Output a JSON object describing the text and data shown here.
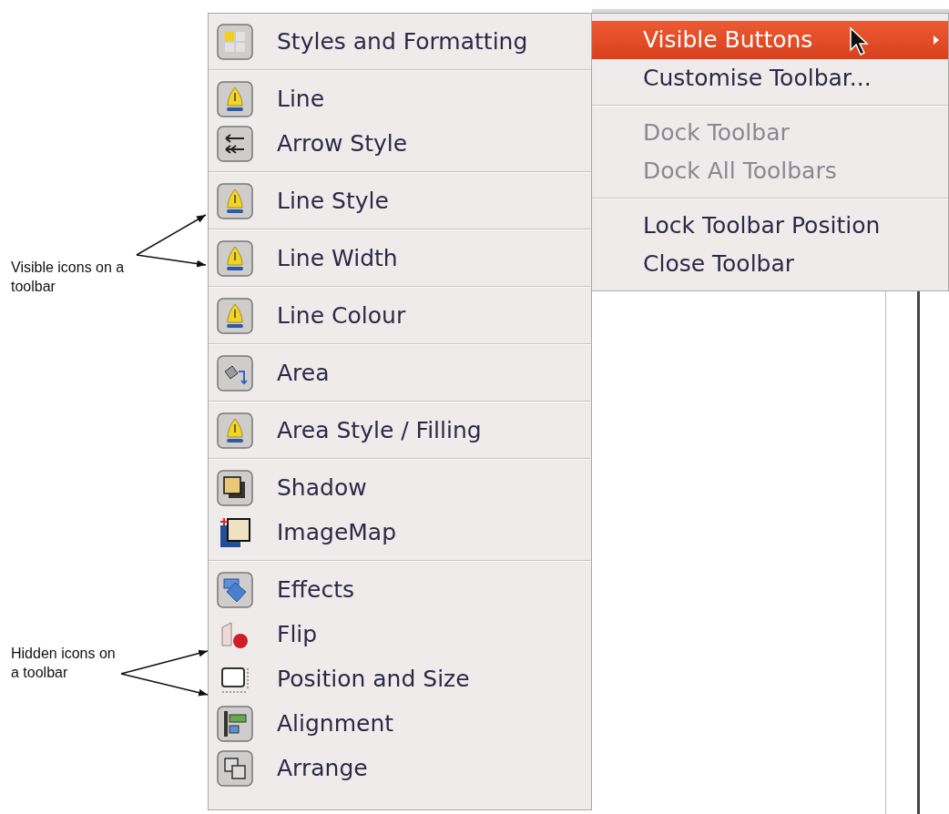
{
  "annotations": [
    {
      "text": "Visible icons on a toolbar"
    },
    {
      "text": "Hidden icons on a toolbar"
    }
  ],
  "menu": {
    "groups": [
      {
        "items": [
          {
            "label": "Styles and Formatting",
            "kind": "styles",
            "visible": true
          }
        ]
      },
      {
        "items": [
          {
            "label": "Line",
            "kind": "pen",
            "visible": true
          },
          {
            "label": "Arrow Style",
            "kind": "arrows",
            "visible": true
          }
        ]
      },
      {
        "items": [
          {
            "label": "Line Style",
            "kind": "pen",
            "visible": true
          }
        ]
      },
      {
        "items": [
          {
            "label": "Line Width",
            "kind": "pen",
            "visible": true
          }
        ]
      },
      {
        "items": [
          {
            "label": "Line Colour",
            "kind": "pen",
            "visible": true
          }
        ]
      },
      {
        "items": [
          {
            "label": "Area",
            "kind": "fill",
            "visible": true
          }
        ]
      },
      {
        "items": [
          {
            "label": "Area Style / Filling",
            "kind": "pen",
            "visible": true
          }
        ]
      },
      {
        "items": [
          {
            "label": "Shadow",
            "kind": "shadow",
            "visible": true
          },
          {
            "label": "ImageMap",
            "kind": "imagemap",
            "visible": false
          }
        ]
      },
      {
        "items": [
          {
            "label": "Effects",
            "kind": "effects",
            "visible": true
          },
          {
            "label": "Flip",
            "kind": "flip",
            "visible": false
          },
          {
            "label": "Position and Size",
            "kind": "position",
            "visible": false
          },
          {
            "label": "Alignment",
            "kind": "alignment",
            "visible": true
          },
          {
            "label": "Arrange",
            "kind": "arrange",
            "visible": true
          }
        ]
      }
    ]
  },
  "submenu": {
    "groups": [
      {
        "items": [
          {
            "label": "Visible Buttons",
            "selected": true,
            "disabled": false,
            "has_submenu": true
          },
          {
            "label": "Customise Toolbar...",
            "selected": false,
            "disabled": false,
            "has_submenu": false
          }
        ]
      },
      {
        "items": [
          {
            "label": "Dock Toolbar",
            "selected": false,
            "disabled": true,
            "has_submenu": false
          },
          {
            "label": "Dock All Toolbars",
            "selected": false,
            "disabled": true,
            "has_submenu": false
          }
        ]
      },
      {
        "items": [
          {
            "label": "Lock Toolbar Position",
            "selected": false,
            "disabled": false,
            "has_submenu": false
          },
          {
            "label": "Close Toolbar",
            "selected": false,
            "disabled": false,
            "has_submenu": false
          }
        ]
      }
    ]
  }
}
